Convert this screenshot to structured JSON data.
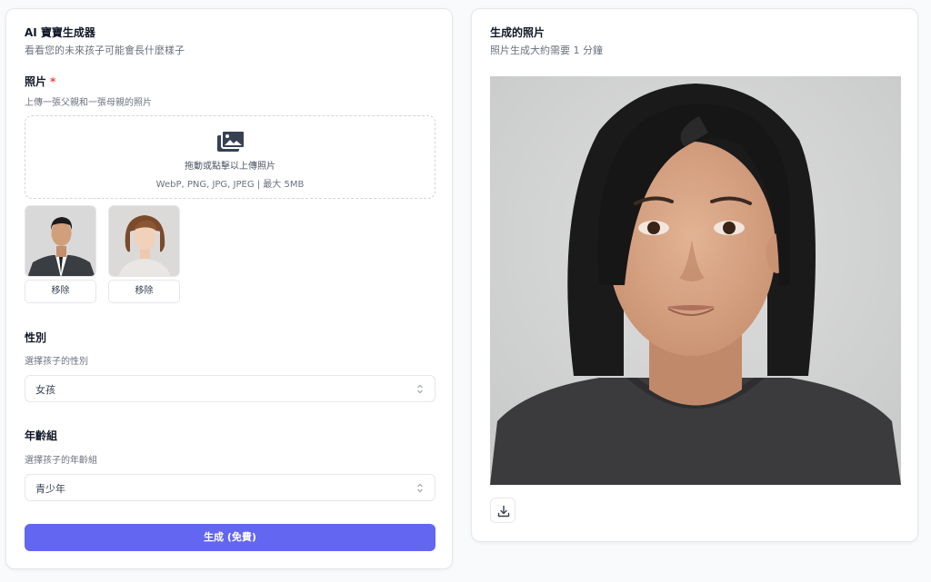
{
  "form": {
    "title": "AI 寶寶生成器",
    "subtitle": "看看您的未來孩子可能會長什麼樣子",
    "photos": {
      "label": "照片",
      "required_mark": "*",
      "hint": "上傳一張父親和一張母親的照片",
      "dropzone_text": "拖動或點擊以上傳照片",
      "dropzone_formats": "WebP, PNG, JPG, JPEG | 最大 5MB",
      "dropzone_icon": "images-icon",
      "uploads": [
        {
          "subject": "father",
          "remove_label": "移除"
        },
        {
          "subject": "mother",
          "remove_label": "移除"
        }
      ]
    },
    "gender": {
      "label": "性別",
      "hint": "選擇孩子的性別",
      "value": "女孩"
    },
    "age_group": {
      "label": "年齡組",
      "hint": "選擇孩子的年齡組",
      "value": "青少年"
    },
    "generate_label": "生成 (免費)"
  },
  "result": {
    "title": "生成的照片",
    "subtitle": "照片生成大約需要 1 分鐘",
    "download_icon": "download-icon"
  },
  "colors": {
    "primary": "#6366f1",
    "required": "#ef4444",
    "border": "#e5e7eb",
    "muted_text": "#6b7280"
  }
}
